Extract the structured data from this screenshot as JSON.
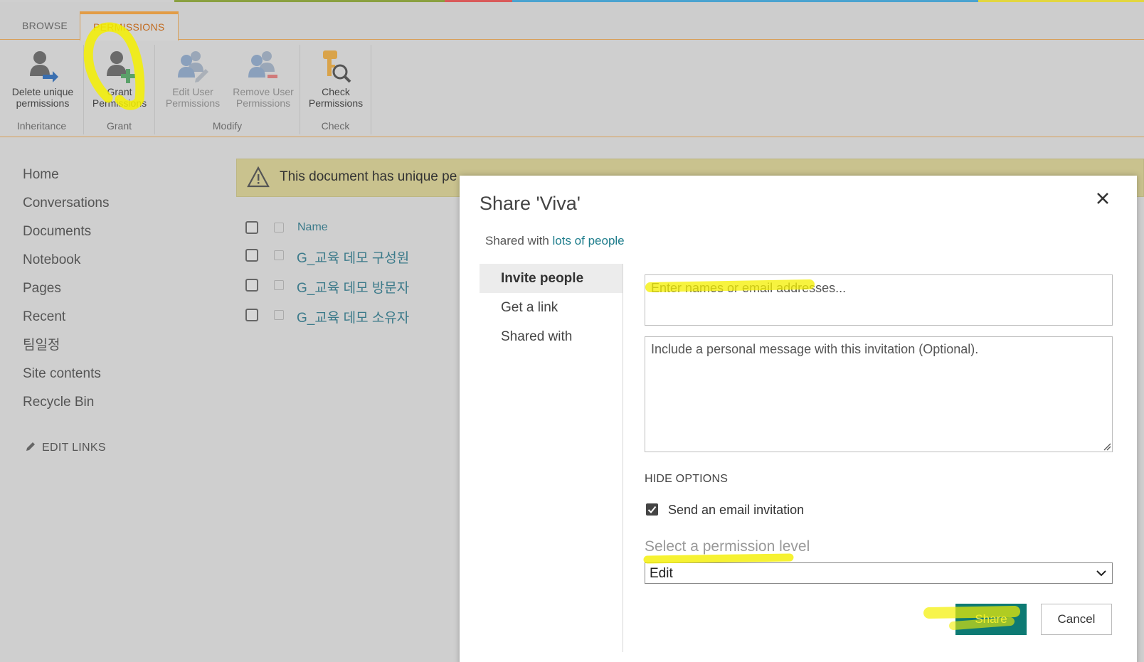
{
  "ribbon": {
    "tabs": [
      {
        "label": "BROWSE"
      },
      {
        "label": "PERMISSIONS"
      }
    ],
    "groups": [
      {
        "label": "Inheritance",
        "buttons": [
          {
            "line1": "Delete unique",
            "line2": "permissions",
            "icon": "delete-unique-permissions-icon"
          }
        ]
      },
      {
        "label": "Grant",
        "buttons": [
          {
            "line1": "Grant",
            "line2": "Permissions",
            "icon": "grant-permissions-icon"
          }
        ]
      },
      {
        "label": "Modify",
        "buttons": [
          {
            "line1": "Edit User",
            "line2": "Permissions",
            "icon": "edit-user-permissions-icon"
          },
          {
            "line1": "Remove User",
            "line2": "Permissions",
            "icon": "remove-user-permissions-icon"
          }
        ]
      },
      {
        "label": "Check",
        "buttons": [
          {
            "line1": "Check",
            "line2": "Permissions",
            "icon": "check-permissions-icon"
          }
        ]
      }
    ]
  },
  "leftnav": {
    "items": [
      "Home",
      "Conversations",
      "Documents",
      "Notebook",
      "Pages",
      "Recent",
      "팀일정",
      "Site contents",
      "Recycle Bin"
    ],
    "edit_links": "EDIT LINKS"
  },
  "warning": {
    "text": "This document has unique pe"
  },
  "list": {
    "header": "Name",
    "rows": [
      "G_교육 데모 구성원",
      "G_교육 데모 방문자",
      "G_교육 데모 소유자"
    ]
  },
  "dialog": {
    "title": "Share 'Viva'",
    "shared_prefix": "Shared with ",
    "shared_link": "lots of people",
    "nav": [
      "Invite people",
      "Get a link",
      "Shared with"
    ],
    "names_placeholder": "Enter names or email addresses...",
    "message_placeholder": "Include a personal message with this invitation (Optional).",
    "hide_options": "HIDE OPTIONS",
    "send_email_label": "Send an email invitation",
    "send_email_checked": true,
    "permission_label": "Select a permission level",
    "permission_value": "Edit",
    "share_button": "Share",
    "cancel_button": "Cancel"
  },
  "colors": {
    "accent": "#e29c46",
    "link": "#1e7d8c",
    "share_bg": "#0d7a73",
    "highlight": "#f5f000"
  }
}
